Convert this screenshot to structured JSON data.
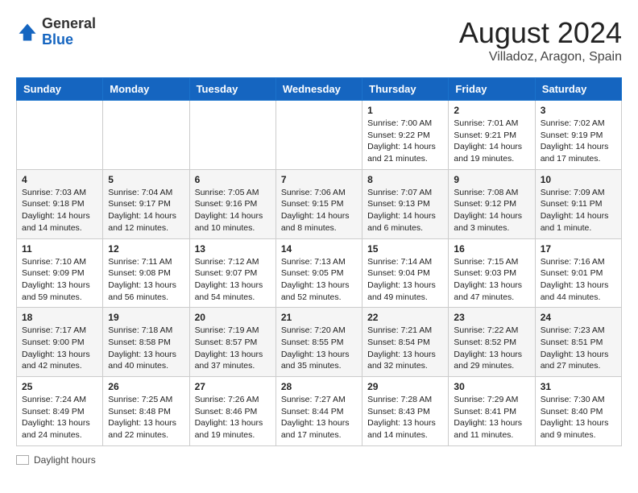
{
  "header": {
    "logo_general": "General",
    "logo_blue": "Blue",
    "month_year": "August 2024",
    "location": "Villadoz, Aragon, Spain"
  },
  "days_of_week": [
    "Sunday",
    "Monday",
    "Tuesday",
    "Wednesday",
    "Thursday",
    "Friday",
    "Saturday"
  ],
  "weeks": [
    [
      {
        "day": "",
        "info": ""
      },
      {
        "day": "",
        "info": ""
      },
      {
        "day": "",
        "info": ""
      },
      {
        "day": "",
        "info": ""
      },
      {
        "day": "1",
        "info": "Sunrise: 7:00 AM\nSunset: 9:22 PM\nDaylight: 14 hours and 21 minutes."
      },
      {
        "day": "2",
        "info": "Sunrise: 7:01 AM\nSunset: 9:21 PM\nDaylight: 14 hours and 19 minutes."
      },
      {
        "day": "3",
        "info": "Sunrise: 7:02 AM\nSunset: 9:19 PM\nDaylight: 14 hours and 17 minutes."
      }
    ],
    [
      {
        "day": "4",
        "info": "Sunrise: 7:03 AM\nSunset: 9:18 PM\nDaylight: 14 hours and 14 minutes."
      },
      {
        "day": "5",
        "info": "Sunrise: 7:04 AM\nSunset: 9:17 PM\nDaylight: 14 hours and 12 minutes."
      },
      {
        "day": "6",
        "info": "Sunrise: 7:05 AM\nSunset: 9:16 PM\nDaylight: 14 hours and 10 minutes."
      },
      {
        "day": "7",
        "info": "Sunrise: 7:06 AM\nSunset: 9:15 PM\nDaylight: 14 hours and 8 minutes."
      },
      {
        "day": "8",
        "info": "Sunrise: 7:07 AM\nSunset: 9:13 PM\nDaylight: 14 hours and 6 minutes."
      },
      {
        "day": "9",
        "info": "Sunrise: 7:08 AM\nSunset: 9:12 PM\nDaylight: 14 hours and 3 minutes."
      },
      {
        "day": "10",
        "info": "Sunrise: 7:09 AM\nSunset: 9:11 PM\nDaylight: 14 hours and 1 minute."
      }
    ],
    [
      {
        "day": "11",
        "info": "Sunrise: 7:10 AM\nSunset: 9:09 PM\nDaylight: 13 hours and 59 minutes."
      },
      {
        "day": "12",
        "info": "Sunrise: 7:11 AM\nSunset: 9:08 PM\nDaylight: 13 hours and 56 minutes."
      },
      {
        "day": "13",
        "info": "Sunrise: 7:12 AM\nSunset: 9:07 PM\nDaylight: 13 hours and 54 minutes."
      },
      {
        "day": "14",
        "info": "Sunrise: 7:13 AM\nSunset: 9:05 PM\nDaylight: 13 hours and 52 minutes."
      },
      {
        "day": "15",
        "info": "Sunrise: 7:14 AM\nSunset: 9:04 PM\nDaylight: 13 hours and 49 minutes."
      },
      {
        "day": "16",
        "info": "Sunrise: 7:15 AM\nSunset: 9:03 PM\nDaylight: 13 hours and 47 minutes."
      },
      {
        "day": "17",
        "info": "Sunrise: 7:16 AM\nSunset: 9:01 PM\nDaylight: 13 hours and 44 minutes."
      }
    ],
    [
      {
        "day": "18",
        "info": "Sunrise: 7:17 AM\nSunset: 9:00 PM\nDaylight: 13 hours and 42 minutes."
      },
      {
        "day": "19",
        "info": "Sunrise: 7:18 AM\nSunset: 8:58 PM\nDaylight: 13 hours and 40 minutes."
      },
      {
        "day": "20",
        "info": "Sunrise: 7:19 AM\nSunset: 8:57 PM\nDaylight: 13 hours and 37 minutes."
      },
      {
        "day": "21",
        "info": "Sunrise: 7:20 AM\nSunset: 8:55 PM\nDaylight: 13 hours and 35 minutes."
      },
      {
        "day": "22",
        "info": "Sunrise: 7:21 AM\nSunset: 8:54 PM\nDaylight: 13 hours and 32 minutes."
      },
      {
        "day": "23",
        "info": "Sunrise: 7:22 AM\nSunset: 8:52 PM\nDaylight: 13 hours and 29 minutes."
      },
      {
        "day": "24",
        "info": "Sunrise: 7:23 AM\nSunset: 8:51 PM\nDaylight: 13 hours and 27 minutes."
      }
    ],
    [
      {
        "day": "25",
        "info": "Sunrise: 7:24 AM\nSunset: 8:49 PM\nDaylight: 13 hours and 24 minutes."
      },
      {
        "day": "26",
        "info": "Sunrise: 7:25 AM\nSunset: 8:48 PM\nDaylight: 13 hours and 22 minutes."
      },
      {
        "day": "27",
        "info": "Sunrise: 7:26 AM\nSunset: 8:46 PM\nDaylight: 13 hours and 19 minutes."
      },
      {
        "day": "28",
        "info": "Sunrise: 7:27 AM\nSunset: 8:44 PM\nDaylight: 13 hours and 17 minutes."
      },
      {
        "day": "29",
        "info": "Sunrise: 7:28 AM\nSunset: 8:43 PM\nDaylight: 13 hours and 14 minutes."
      },
      {
        "day": "30",
        "info": "Sunrise: 7:29 AM\nSunset: 8:41 PM\nDaylight: 13 hours and 11 minutes."
      },
      {
        "day": "31",
        "info": "Sunrise: 7:30 AM\nSunset: 8:40 PM\nDaylight: 13 hours and 9 minutes."
      }
    ]
  ],
  "legend": {
    "label": "Daylight hours"
  }
}
